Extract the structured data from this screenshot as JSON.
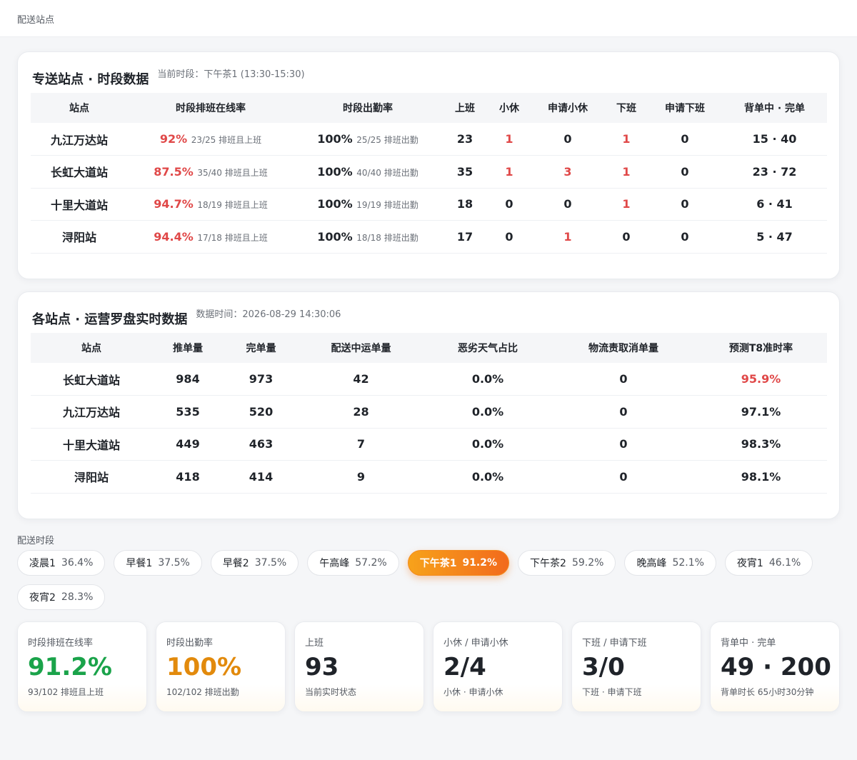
{
  "header": {
    "breadcrumb": "配送站点"
  },
  "card1": {
    "title": "专送站点 · 时段数据",
    "meta": "当前时段：下午茶1 (13:30-15:30)",
    "columns": [
      "站点",
      "时段排班在线率",
      "时段出勤率",
      "上班",
      "小休",
      "申请小休",
      "下班",
      "申请下班",
      "背单中 · 完单"
    ],
    "rows": [
      {
        "station": "九江万达站",
        "online": "92%",
        "online_sub": "23/25 排班且上班",
        "attend": "100%",
        "attend_sub": "25/25 排班出勤",
        "onduty": "23",
        "rest": "1",
        "apply_rest": "0",
        "off": "1",
        "apply_off": "0",
        "carry": "15 · 40"
      },
      {
        "station": "长虹大道站",
        "online": "87.5%",
        "online_sub": "35/40 排班且上班",
        "attend": "100%",
        "attend_sub": "40/40 排班出勤",
        "onduty": "35",
        "rest": "1",
        "apply_rest": "3",
        "off": "1",
        "apply_off": "0",
        "carry": "23 · 72"
      },
      {
        "station": "十里大道站",
        "online": "94.7%",
        "online_sub": "18/19 排班且上班",
        "attend": "100%",
        "attend_sub": "19/19 排班出勤",
        "onduty": "18",
        "rest": "0",
        "apply_rest": "0",
        "off": "1",
        "apply_off": "0",
        "carry": "6 · 41"
      },
      {
        "station": "浔阳站",
        "online": "94.4%",
        "online_sub": "17/18 排班且上班",
        "attend": "100%",
        "attend_sub": "18/18 排班出勤",
        "onduty": "17",
        "rest": "0",
        "apply_rest": "1",
        "off": "0",
        "apply_off": "0",
        "carry": "5 · 47"
      }
    ]
  },
  "card2": {
    "title": "各站点 · 运营罗盘实时数据",
    "meta": "数据时间：2026-08-29 14:30:06",
    "columns": [
      "站点",
      "推单量",
      "完单量",
      "配送中运单量",
      "恶劣天气占比",
      "物流责取消单量",
      "预测T8准时率"
    ],
    "rows": [
      {
        "station": "长虹大道站",
        "push": "984",
        "done": "973",
        "delivering": "42",
        "weather": "0.0%",
        "cancel": "0",
        "t8": "95.9%"
      },
      {
        "station": "九江万达站",
        "push": "535",
        "done": "520",
        "delivering": "28",
        "weather": "0.0%",
        "cancel": "0",
        "t8": "97.1%"
      },
      {
        "station": "十里大道站",
        "push": "449",
        "done": "463",
        "delivering": "7",
        "weather": "0.0%",
        "cancel": "0",
        "t8": "98.3%"
      },
      {
        "station": "浔阳站",
        "push": "418",
        "done": "414",
        "delivering": "9",
        "weather": "0.0%",
        "cancel": "0",
        "t8": "98.1%"
      }
    ]
  },
  "segments": {
    "label": "配送时段",
    "items": [
      {
        "name": "凌晨1",
        "pct": "36.4%"
      },
      {
        "name": "早餐1",
        "pct": "37.5%"
      },
      {
        "name": "早餐2",
        "pct": "37.5%"
      },
      {
        "name": "午高峰",
        "pct": "57.2%"
      },
      {
        "name": "下午茶1",
        "pct": "91.2%",
        "active": true
      },
      {
        "name": "下午茶2",
        "pct": "59.2%"
      },
      {
        "name": "晚高峰",
        "pct": "52.1%"
      },
      {
        "name": "夜宵1",
        "pct": "46.1%"
      },
      {
        "name": "夜宵2",
        "pct": "28.3%"
      }
    ]
  },
  "stats": [
    {
      "label": "时段排班在线率",
      "value": "91.2%",
      "note": "93/102 排班且上班",
      "color": "#1aa34a"
    },
    {
      "label": "时段出勤率",
      "value": "100%",
      "note": "102/102 排班出勤",
      "color": "#e28a0c"
    },
    {
      "label": "上班",
      "value": "93",
      "note": "当前实时状态"
    },
    {
      "label": "小休 / 申请小休",
      "value": "2/4",
      "note": "小休 · 申请小休"
    },
    {
      "label": "下班 / 申请下班",
      "value": "3/0",
      "note": "下班 · 申请下班"
    },
    {
      "label": "背单中 · 完单",
      "value": "49 · 200",
      "note": "背单时长 65小时30分钟"
    }
  ],
  "colors": {
    "red": "#e04848",
    "green": "#1aa34a",
    "orange": "#e28a0c",
    "accent": "#f26a1c"
  }
}
